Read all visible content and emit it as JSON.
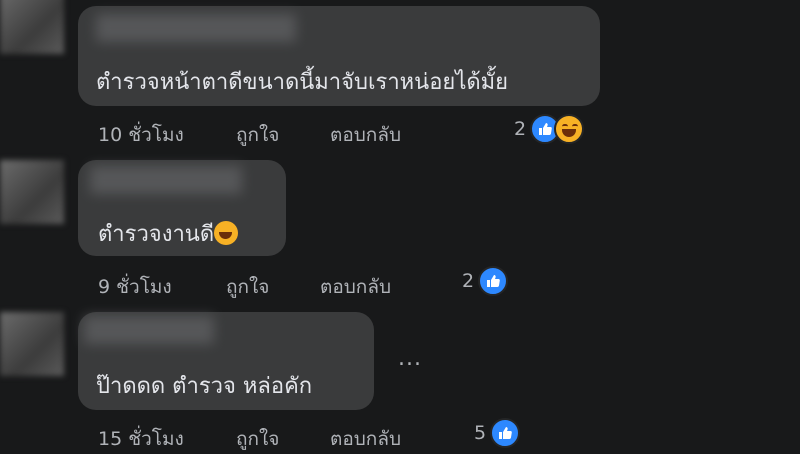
{
  "comments": [
    {
      "text": "ตำรวจหน้าตาดีขนาดนี้มาจับเราหน่อยได้มั้ย",
      "time": "10 ชั่วโมง",
      "like": "ถูกใจ",
      "reply": "ตอบกลับ",
      "reaction_count": "2",
      "reaction_icons": [
        "like-icon",
        "haha-icon"
      ]
    },
    {
      "text": "ตำรวจงานดี",
      "text_emoji": "rofl-emoji",
      "time": "9 ชั่วโมง",
      "like": "ถูกใจ",
      "reply": "ตอบกลับ",
      "reaction_count": "2",
      "reaction_icons": [
        "like-icon"
      ]
    },
    {
      "text": "ป๊าดดด ตำรวจ หล่อคัก",
      "time": "15 ชั่วโมง",
      "like": "ถูกใจ",
      "reply": "ตอบกลับ",
      "reaction_count": "5",
      "reaction_icons": [
        "like-icon"
      ],
      "more_label": "..."
    }
  ],
  "colors": {
    "background": "#18191a",
    "bubble": "#3a3b3c",
    "text": "#e4e6eb",
    "meta": "#b0b3b8",
    "like_blue": "#2d88ff"
  }
}
